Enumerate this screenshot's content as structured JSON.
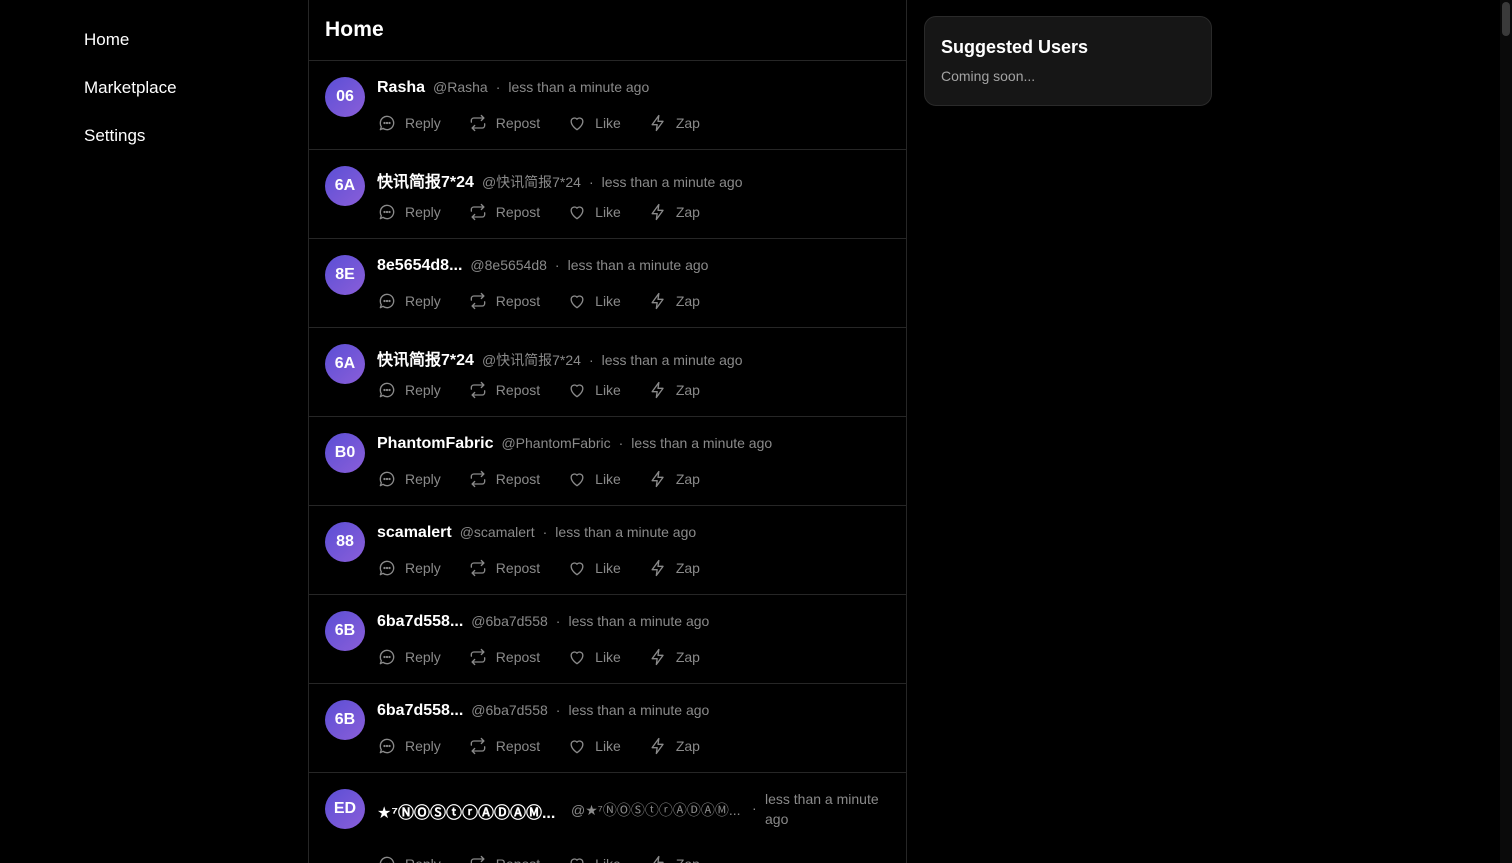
{
  "nav": {
    "items": [
      {
        "label": "Home"
      },
      {
        "label": "Marketplace"
      },
      {
        "label": "Settings"
      }
    ]
  },
  "feed": {
    "title": "Home",
    "action_labels": {
      "reply": "Reply",
      "repost": "Repost",
      "like": "Like",
      "zap": "Zap"
    },
    "posts": [
      {
        "avatar": "06",
        "author": "Rasha",
        "handle": "@Rasha",
        "time": "less than a minute ago"
      },
      {
        "avatar": "6A",
        "author": "快讯简报7*24",
        "handle": "@快讯简报7*24",
        "time": "less than a minute ago"
      },
      {
        "avatar": "8E",
        "author": "8e5654d8...",
        "handle": "@8e5654d8",
        "time": "less than a minute ago"
      },
      {
        "avatar": "6A",
        "author": "快讯简报7*24",
        "handle": "@快讯简报7*24",
        "time": "less than a minute ago"
      },
      {
        "avatar": "B0",
        "author": "PhantomFabric",
        "handle": "@PhantomFabric",
        "time": "less than a minute ago"
      },
      {
        "avatar": "88",
        "author": "scamalert",
        "handle": "@scamalert",
        "time": "less than a minute ago"
      },
      {
        "avatar": "6B",
        "author": "6ba7d558...",
        "handle": "@6ba7d558",
        "time": "less than a minute ago"
      },
      {
        "avatar": "6B",
        "author": "6ba7d558...",
        "handle": "@6ba7d558",
        "time": "less than a minute ago"
      },
      {
        "avatar": "ED",
        "author": "★⁷ⓃⓄⓈⓣⓡⒶⒹⒶⓂ...",
        "handle": "@★⁷ⓃⓄⓈⓣⓡⒶⒹⒶⓂ...",
        "time": "less than a minute ago"
      }
    ]
  },
  "suggested": {
    "title": "Suggested Users",
    "body": "Coming soon..."
  }
}
